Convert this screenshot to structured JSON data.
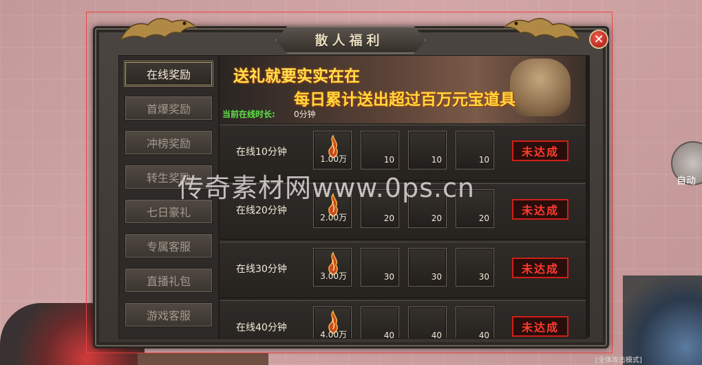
{
  "window": {
    "title": "散人福利",
    "close_glyph": "✕"
  },
  "sidebar": {
    "items": [
      {
        "label": "在线奖励",
        "active": true
      },
      {
        "label": "首爆奖励",
        "active": false
      },
      {
        "label": "冲榜奖励",
        "active": false
      },
      {
        "label": "转生奖励",
        "active": false
      },
      {
        "label": "七日豪礼",
        "active": false
      },
      {
        "label": "专属客服",
        "active": false
      },
      {
        "label": "直播礼包",
        "active": false
      },
      {
        "label": "游戏客服",
        "active": false
      }
    ]
  },
  "banner": {
    "line1": "送礼就要实实在在",
    "line2": "每日累计送出超过百万元宝道具"
  },
  "online": {
    "label": "当前在线时长:",
    "value": "0分钟"
  },
  "rewards": [
    {
      "label": "在线10分钟",
      "slots": [
        "1.00万",
        "10",
        "10",
        "10"
      ],
      "status": "未达成"
    },
    {
      "label": "在线20分钟",
      "slots": [
        "2.00万",
        "20",
        "20",
        "20"
      ],
      "status": "未达成"
    },
    {
      "label": "在线30分钟",
      "slots": [
        "3.00万",
        "30",
        "30",
        "30"
      ],
      "status": "未达成"
    },
    {
      "label": "在线40分钟",
      "slots": [
        "4.00万",
        "40",
        "40",
        "40"
      ],
      "status": "未达成"
    }
  ],
  "hud": {
    "auto_label": "自动",
    "attack_mode": "[全体攻击模式]"
  },
  "watermark": "传奇素材网www.0ps.cn",
  "colors": {
    "status_red": "#ff3b2f",
    "online_green": "#5ee34a",
    "banner_gold": "#ffe24a"
  }
}
